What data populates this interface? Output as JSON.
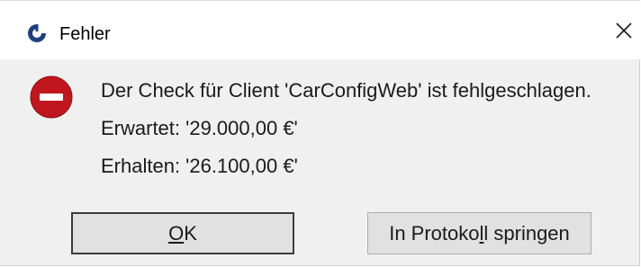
{
  "window": {
    "title": "Fehler",
    "app_icon": "app-logo-icon",
    "close_icon": "close-icon"
  },
  "message": {
    "icon": "error-stop-icon",
    "line1": "Der Check für Client 'CarConfigWeb' ist fehlgeschlagen.",
    "line2": "Erwartet: '29.000,00 €'",
    "line3": "Erhalten: '26.100,00 €'"
  },
  "buttons": {
    "ok": {
      "mnemonic": "O",
      "rest": "K"
    },
    "protocol": {
      "before": "In Protoko",
      "mnemonic": "l",
      "after": "l springen"
    }
  },
  "colors": {
    "error_red": "#c0171e",
    "app_icon_blue": "#1f3f7a",
    "dialog_bg": "#f0f0f0",
    "titlebar_bg": "#ffffff"
  }
}
